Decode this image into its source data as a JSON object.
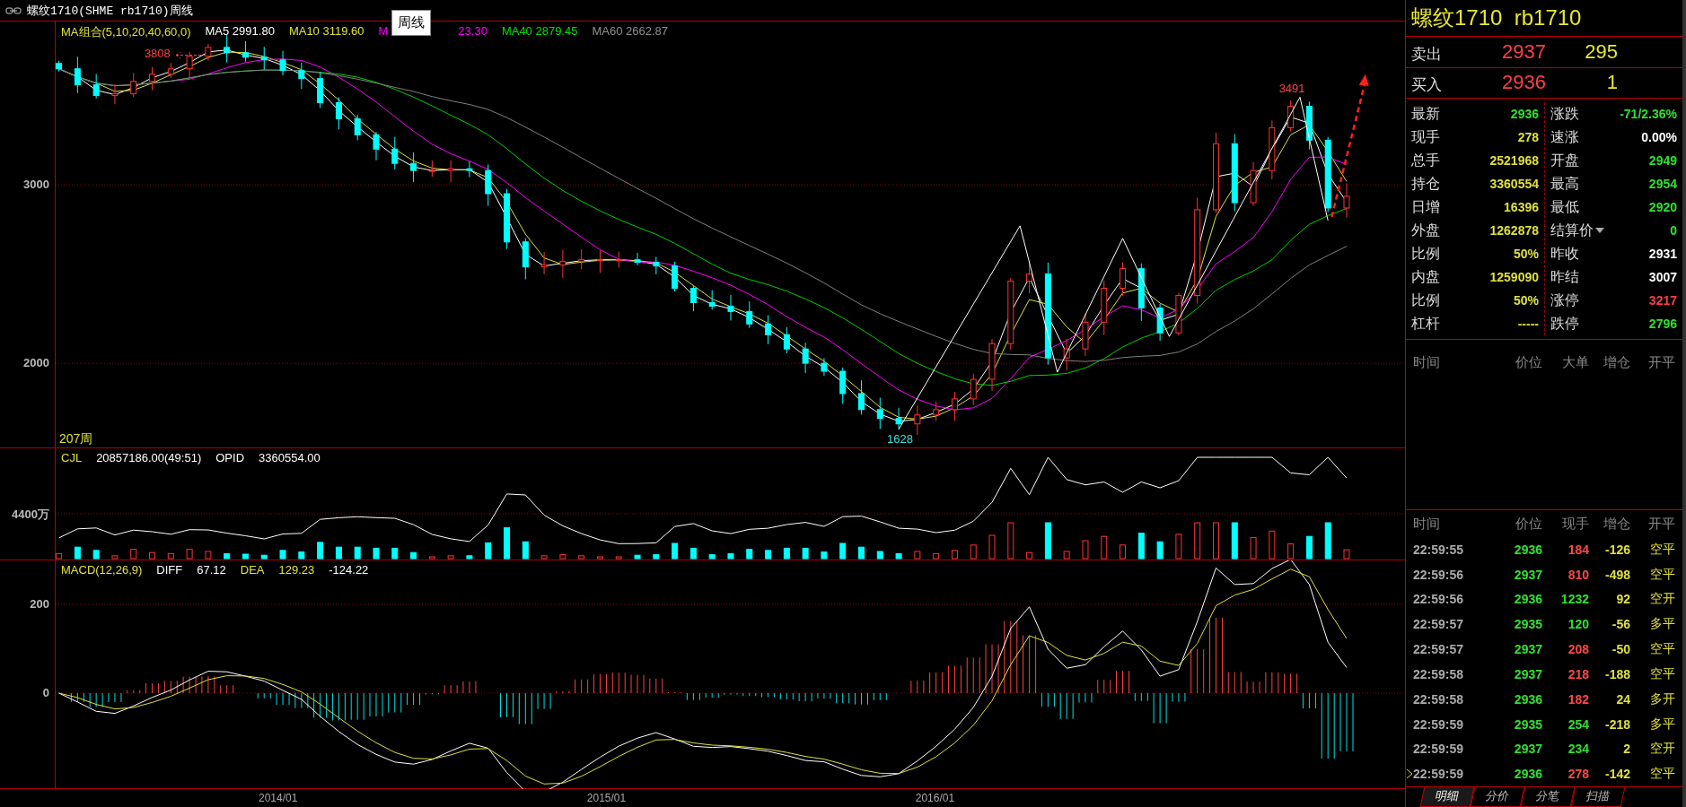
{
  "title_bar": {
    "text": "螺纹1710(SHME rb1710)周线"
  },
  "main_chart": {
    "legend": [
      {
        "kind": "text",
        "text": "MA组合(5,10,20,40,60,0)",
        "color": "#e0e040"
      },
      {
        "kind": "text",
        "text": "MA5 2991.80",
        "color": "#ffffff"
      },
      {
        "kind": "text",
        "text": "MA10 3119.60",
        "color": "#e0e040"
      },
      {
        "kind": "text",
        "text": "M",
        "color": "#ff00ff"
      },
      {
        "kind": "tooltip",
        "text": "周线"
      },
      {
        "kind": "text",
        "text": "23.30",
        "color": "#ff00ff"
      },
      {
        "kind": "text",
        "text": "MA40 2879.45",
        "color": "#00e000"
      },
      {
        "kind": "text",
        "text": "MA60 2662.87",
        "color": "#909090"
      }
    ],
    "period_count": "207周",
    "y_axis_labels": [
      "3000",
      "2000"
    ],
    "price_labels": [
      {
        "text": "3808",
        "color": "#ff4040"
      },
      {
        "text": "3491",
        "color": "#ff4040"
      },
      {
        "text": "1628",
        "color": "#40e0e0"
      }
    ]
  },
  "volume_chart": {
    "legend": [
      {
        "text": "CJL",
        "color": "#e0e040"
      },
      {
        "text": "20857186.00(49:51)",
        "color": "#ffffff"
      },
      {
        "text": "OPID",
        "color": "#ffffff"
      },
      {
        "text": "3360554.00",
        "color": "#ffffff"
      }
    ],
    "axis_label": "4400万"
  },
  "macd_chart": {
    "legend": [
      {
        "text": "MACD(12,26,9)",
        "color": "#e0e040"
      },
      {
        "text": "DIFF",
        "color": "#ffffff"
      },
      {
        "text": "67.12",
        "color": "#ffffff"
      },
      {
        "text": "DEA",
        "color": "#e0e040"
      },
      {
        "text": "129.23",
        "color": "#e0e040"
      },
      {
        "text": "-124.22",
        "color": "#ffffff"
      }
    ],
    "y_axis_labels": [
      "200",
      "0"
    ]
  },
  "x_axis_labels": [
    "2014/01",
    "2015/01",
    "2016/01"
  ],
  "quote_panel": {
    "header": "螺纹1710  rb1710",
    "sell": {
      "label": "卖出",
      "price": "2937",
      "volume": "295"
    },
    "buy": {
      "label": "买入",
      "price": "2936",
      "volume": "1"
    },
    "left": [
      {
        "label": "最新",
        "value": "2936",
        "color": "#30e030"
      },
      {
        "label": "现手",
        "value": "278",
        "color": "#e0e040"
      },
      {
        "label": "总手",
        "value": "2521968",
        "color": "#e0e040"
      },
      {
        "label": "持仓",
        "value": "3360554",
        "color": "#e0e040"
      },
      {
        "label": "日增",
        "value": "16396",
        "color": "#e0e040"
      },
      {
        "label": "外盘",
        "value": "1262878",
        "color": "#e0e040"
      },
      {
        "label": "比例",
        "value": "50%",
        "color": "#e0e040"
      },
      {
        "label": "内盘",
        "value": "1259090",
        "color": "#e0e040"
      },
      {
        "label": "比例",
        "value": "50%",
        "color": "#e0e040"
      },
      {
        "label": "杠杆",
        "value": "-----",
        "color": "#e0e040"
      }
    ],
    "right": [
      {
        "kind": "plain",
        "label": "涨跌",
        "value": "-71/2.36%",
        "color": "#30e030"
      },
      {
        "kind": "plain",
        "label": "速涨",
        "value": "0.00%",
        "color": "#ffffff"
      },
      {
        "kind": "plain",
        "label": "开盘",
        "value": "2949",
        "color": "#30e030"
      },
      {
        "kind": "plain",
        "label": "最高",
        "value": "2954",
        "color": "#30e030"
      },
      {
        "kind": "plain",
        "label": "最低",
        "value": "2920",
        "color": "#30e030"
      },
      {
        "kind": "dropdown",
        "label": "结算价",
        "value": "0",
        "color": "#30e030"
      },
      {
        "kind": "plain",
        "label": "昨收",
        "value": "2931",
        "color": "#ffffff"
      },
      {
        "kind": "plain",
        "label": "昨结",
        "value": "3007",
        "color": "#ffffff"
      },
      {
        "kind": "plain",
        "label": "涨停",
        "value": "3217",
        "color": "#ff4040"
      },
      {
        "kind": "plain",
        "label": "跌停",
        "value": "2796",
        "color": "#30e030"
      }
    ]
  },
  "big_orders": {
    "columns": [
      "时间",
      "价位",
      "大单",
      "增仓",
      "开平"
    ]
  },
  "trades": {
    "columns": [
      "时间",
      "价位",
      "现手",
      "增仓",
      "开平"
    ],
    "rows": [
      {
        "time": "22:59:55",
        "price": "2936",
        "hand": "184",
        "change": "-126",
        "type": "空平",
        "color": "#ff4848",
        "current": false
      },
      {
        "time": "22:59:56",
        "price": "2937",
        "hand": "810",
        "change": "-498",
        "type": "空平",
        "color": "#ff4848",
        "current": false
      },
      {
        "time": "22:59:56",
        "price": "2936",
        "hand": "1232",
        "change": "92",
        "type": "空开",
        "color": "#30e030",
        "current": false
      },
      {
        "time": "22:59:57",
        "price": "2935",
        "hand": "120",
        "change": "-56",
        "type": "多平",
        "color": "#30e030",
        "current": false
      },
      {
        "time": "22:59:57",
        "price": "2937",
        "hand": "208",
        "change": "-50",
        "type": "空平",
        "color": "#ff4848",
        "current": false
      },
      {
        "time": "22:59:58",
        "price": "2937",
        "hand": "218",
        "change": "-188",
        "type": "空平",
        "color": "#ff4848",
        "current": false
      },
      {
        "time": "22:59:58",
        "price": "2936",
        "hand": "182",
        "change": "24",
        "type": "多开",
        "color": "#ff4848",
        "current": false
      },
      {
        "time": "22:59:59",
        "price": "2935",
        "hand": "254",
        "change": "-218",
        "type": "多平",
        "color": "#30e030",
        "current": false
      },
      {
        "time": "22:59:59",
        "price": "2937",
        "hand": "234",
        "change": "2",
        "type": "空开",
        "color": "#30e030",
        "current": false
      },
      {
        "time": "22:59:59",
        "price": "2936",
        "hand": "278",
        "change": "-142",
        "type": "空平",
        "color": "#ff4848",
        "current": true
      }
    ]
  },
  "tabs": [
    {
      "label": "明细",
      "selected": true
    },
    {
      "label": "分价",
      "selected": false
    },
    {
      "label": "分笔",
      "selected": false
    },
    {
      "label": "扫描",
      "selected": false
    }
  ]
}
